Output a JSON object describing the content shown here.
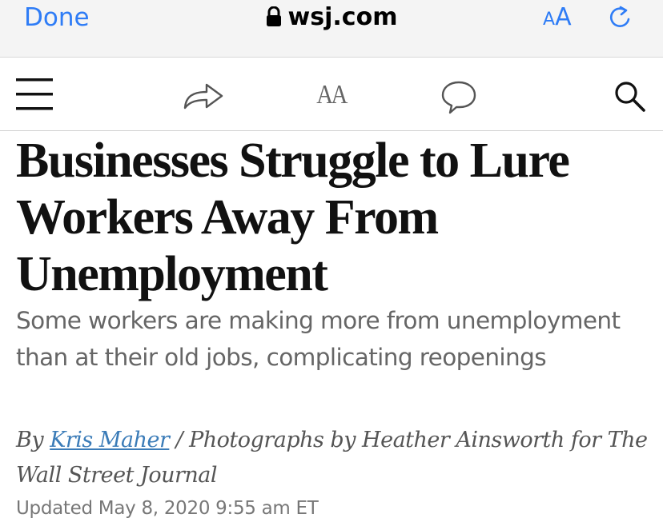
{
  "browser": {
    "done_label": "Done",
    "url": "wsj.com",
    "reader_aa_small": "A",
    "reader_aa_big": "A",
    "accent_color": "#2e7cf6",
    "icons": [
      "lock-icon",
      "reload-icon"
    ]
  },
  "toolbar": {
    "text_size_label": "AA",
    "icons": [
      "menu-icon",
      "share-icon",
      "text-size-icon",
      "comment-icon",
      "search-icon"
    ]
  },
  "article": {
    "headline": "Businesses Struggle to Lure Workers Away From Unemployment",
    "dek": "Some workers are making more from unemployment than at their old jobs, complicating reopenings",
    "byline_prefix": "By ",
    "author": "Kris Maher",
    "byline_rest": " / Photographs by Heather Ainsworth for The Wall Street Journal",
    "updated": "Updated May 8, 2020 9:55 am ET",
    "link_color": "#3b7cb8"
  }
}
